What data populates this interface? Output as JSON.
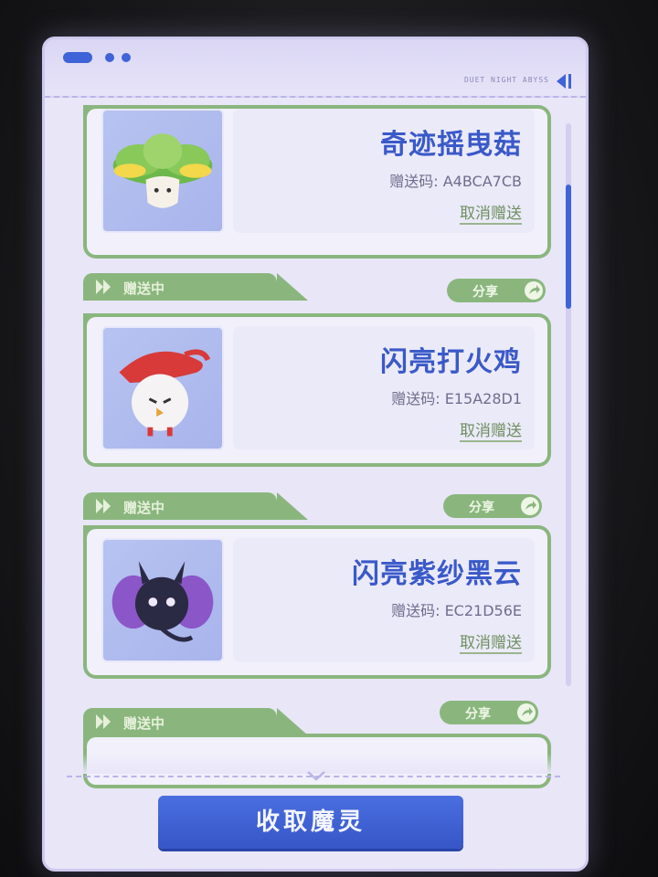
{
  "header": {
    "tag": "DUET NIGHT ABYSS",
    "icons": [
      "dot-pill-icon",
      "dot-icon",
      "dot-icon",
      "collapse-icon"
    ]
  },
  "colors": {
    "accent_blue": "#3f63d8",
    "card_green": "#8ab67e",
    "panel_bg": "#e9e6f8",
    "name_blue": "#3a59c9"
  },
  "scroll": {
    "position_fraction": 0.14
  },
  "gifts": [
    {
      "status": "",
      "share_label": "",
      "name": "奇迹摇曳菇",
      "code_label": "赠送码: ",
      "code": "A4BCA7CB",
      "cancel_label": "取消赠送",
      "pet_icon": "mushroom-pet-icon"
    },
    {
      "status": "赠送中",
      "share_label": "分享",
      "name": "闪亮打火鸡",
      "code_label": "赠送码: ",
      "code": "E15A28D1",
      "cancel_label": "取消赠送",
      "pet_icon": "fire-chick-pet-icon"
    },
    {
      "status": "赠送中",
      "share_label": "分享",
      "name": "闪亮紫纱黑云",
      "code_label": "赠送码: ",
      "code": "EC21D56E",
      "cancel_label": "取消赠送",
      "pet_icon": "dark-cloud-pet-icon"
    },
    {
      "status": "赠送中",
      "share_label": "分享"
    }
  ],
  "footer": {
    "collect_button_label": "收取魔灵"
  }
}
